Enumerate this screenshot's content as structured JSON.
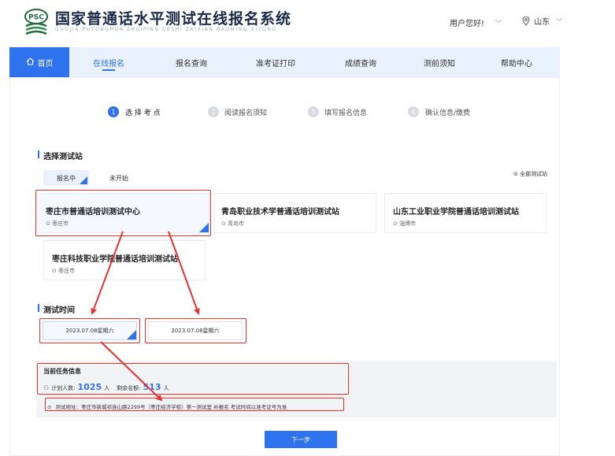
{
  "header": {
    "logo_text": "PSC",
    "title": "国家普通话水平测试在线报名系统",
    "subtitle": "GUOJIA PUTONGHUA SHUIPING CESHI ZAIXIAN BAOMING XITONG",
    "user_greeting": "用户您好!",
    "location": "山东"
  },
  "nav": {
    "home": "首页",
    "items": [
      "在线报名",
      "报名查询",
      "准考证打印",
      "成绩查询",
      "测前须知",
      "帮助中心"
    ]
  },
  "steps": [
    {
      "num": "1",
      "label": "选 择 考 点"
    },
    {
      "num": "2",
      "label": "阅读报名须知"
    },
    {
      "num": "3",
      "label": "填写报名信息"
    },
    {
      "num": "4",
      "label": "确认信息/缴费"
    }
  ],
  "station_section": {
    "title": "选择测试站",
    "tabs": [
      "报名中",
      "未开始"
    ],
    "all_link": "全部测试站",
    "stations": [
      {
        "name": "枣庄市普通话培训测试中心",
        "city": "枣庄市"
      },
      {
        "name": "青岛职业技术学普通话培训测试站",
        "city": "青岛市"
      },
      {
        "name": "山东工业职业学院普通话培训测试站",
        "city": "淄博市"
      },
      {
        "name": "枣庄科技职业学院普通话培训测试站",
        "city": "枣庄市"
      }
    ]
  },
  "time_section": {
    "title": "测试时间",
    "slots": [
      "2023.07.08星期六",
      "2023.07.08星期六"
    ]
  },
  "task_info": {
    "title": "当前任务信息",
    "plan_label": "计划人数:",
    "plan_value": "1025",
    "plan_unit": "人",
    "remain_label": "剩余名额:",
    "remain_value": "513",
    "remain_unit": "人",
    "address": "测试地址：枣庄市新城祁连山路2299号（枣庄经济学校）第一测试室 补报名 考试时间以准考证号为准"
  },
  "next_button": "下一步",
  "colors": {
    "primary": "#2f72ee",
    "annotation_red": "#e8302e",
    "nav_bg": "#e8f1fc"
  }
}
